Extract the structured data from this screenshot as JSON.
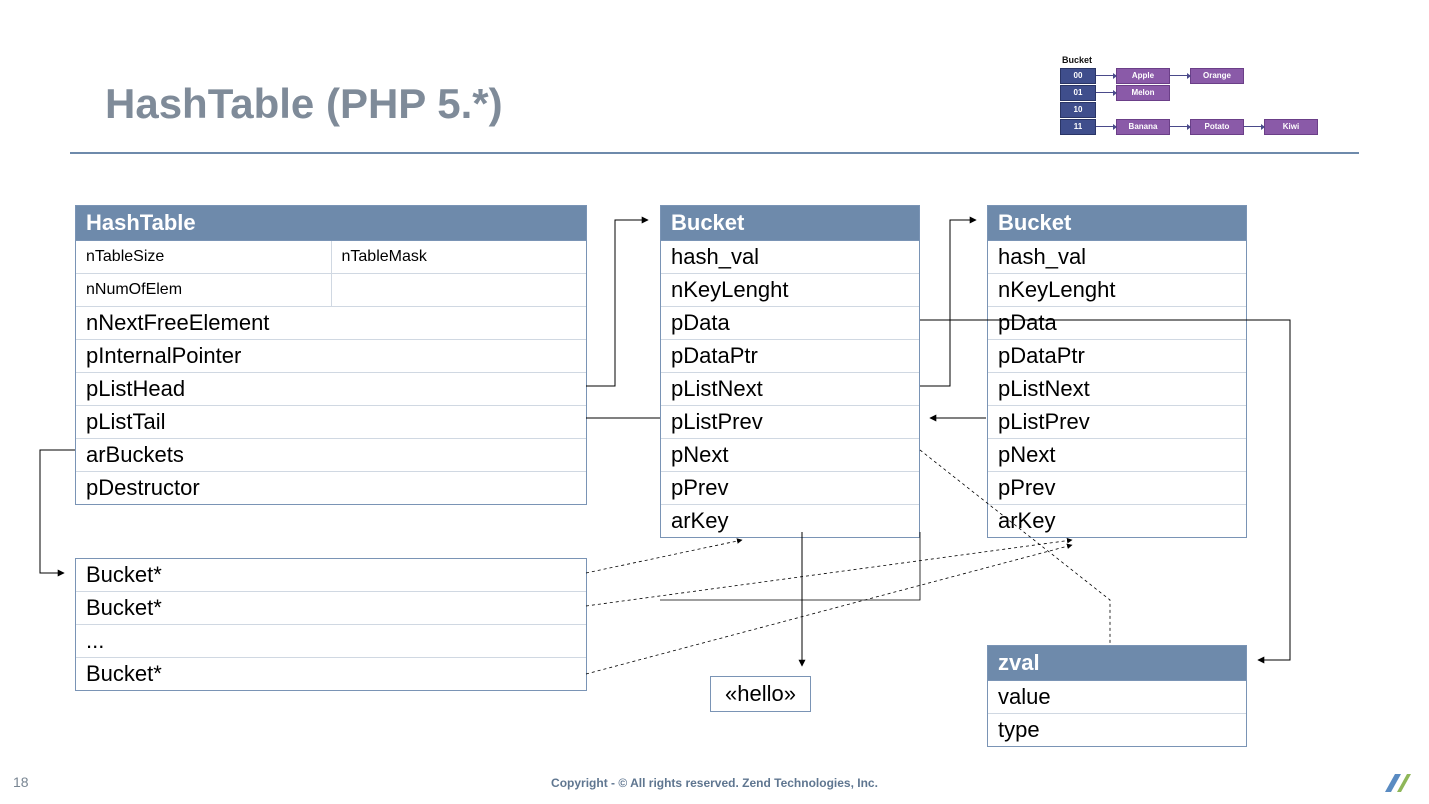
{
  "title": "HashTable (PHP 5.*)",
  "pagenum": "18",
  "copyright": "Copyright - © All rights reserved. Zend Technologies, Inc.",
  "mini": {
    "label": "Bucket",
    "rows": [
      {
        "idx": "00",
        "boxes": [
          "Apple",
          "Orange"
        ]
      },
      {
        "idx": "01",
        "boxes": [
          "Melon"
        ]
      },
      {
        "idx": "10",
        "boxes": []
      },
      {
        "idx": "11",
        "boxes": [
          "Banana",
          "Potato",
          "Kiwi"
        ]
      }
    ]
  },
  "hashTable": {
    "header": "HashTable",
    "row0a": "nTableSize",
    "row0b": "nTableMask",
    "row1a": "nNumOfElem",
    "row1b": "",
    "rows": [
      "nNextFreeElement",
      "pInternalPointer",
      "pListHead",
      "pListTail",
      "arBuckets",
      "pDestructor"
    ]
  },
  "bucketA": {
    "header": "Bucket",
    "rows": [
      "hash_val",
      "nKeyLenght",
      "pData",
      "pDataPtr",
      "pListNext",
      "pListPrev",
      "pNext",
      "pPrev",
      "arKey"
    ]
  },
  "bucketB": {
    "header": "Bucket",
    "rows": [
      "hash_val",
      "nKeyLenght",
      "pData",
      "pDataPtr",
      "pListNext",
      "pListPrev",
      "pNext",
      "pPrev",
      "arKey"
    ]
  },
  "zval": {
    "header": "zval",
    "rows": [
      "value",
      "type"
    ]
  },
  "bucketArray": {
    "rows": [
      "Bucket*",
      "Bucket*",
      "...",
      "Bucket*"
    ]
  },
  "hello": "«hello»"
}
